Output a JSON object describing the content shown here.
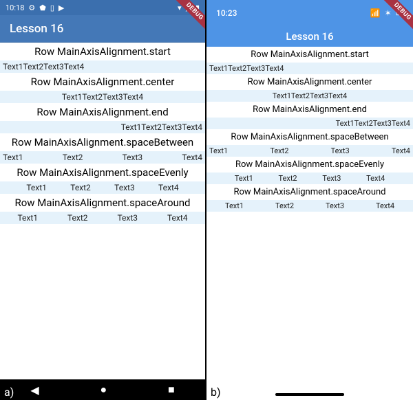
{
  "captions": {
    "a": "a)",
    "b": "b)"
  },
  "debug_label": "DEBUG",
  "android": {
    "status_time": "10:18",
    "app_title": "Lesson 16"
  },
  "ios": {
    "status_time": "10:23",
    "app_title": "Lesson 16"
  },
  "sections": {
    "start": {
      "title": "Row MainAxisAlignment.start"
    },
    "center": {
      "title": "Row MainAxisAlignment.center"
    },
    "end": {
      "title": "Row MainAxisAlignment.end"
    },
    "spaceBetween": {
      "title": "Row MainAxisAlignment.spaceBetween"
    },
    "spaceEvenly": {
      "title": "Row MainAxisAlignment.spaceEvenly"
    },
    "spaceAround": {
      "title": "Row MainAxisAlignment.spaceAround"
    }
  },
  "cells": {
    "t1": "Text1",
    "t2": "Text2",
    "t3": "Text3",
    "t4": "Text4"
  }
}
